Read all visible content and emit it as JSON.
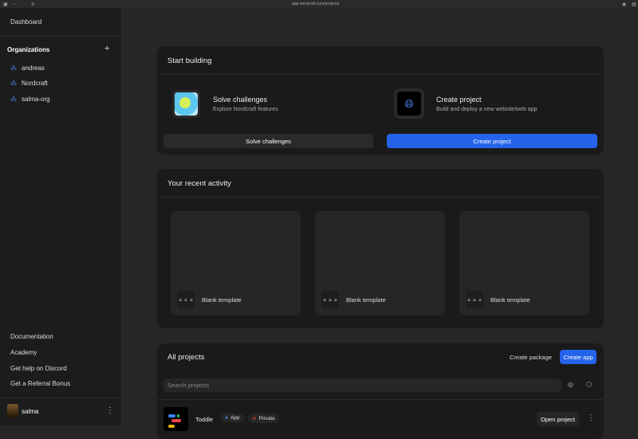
{
  "browser": {
    "url": "app.nordcraft.com/projects"
  },
  "sidebar": {
    "dashboard": "Dashboard",
    "organizations_label": "Organizations",
    "orgs": [
      "andreas",
      "Nordcraft",
      "salma-org"
    ],
    "links": [
      "Documentation",
      "Academy",
      "Get help on Discord",
      "Get a Referral Bonus"
    ],
    "user": "salma"
  },
  "start": {
    "title": "Start building",
    "solve_title": "Solve challenges",
    "solve_desc": "Explore Nordcraft features",
    "create_title": "Create project",
    "create_desc": "Build and deploy a new website/web app",
    "solve_btn": "Solve challenges",
    "create_btn": "Create project"
  },
  "recent": {
    "title": "Your recent activity",
    "templates": [
      "Blank template",
      "Blank template",
      "Blank template"
    ]
  },
  "projects": {
    "title": "All projects",
    "create_package": "Create package",
    "create_app": "Create app",
    "search_placeholder": "Search projects",
    "items": [
      {
        "name": "Toddle",
        "type": "App",
        "visibility": "Private",
        "open": "Open project"
      }
    ]
  },
  "colors": {
    "accent": "#2563eb",
    "card": "#1a1a1a",
    "sidebar": "#1c1c1c"
  }
}
